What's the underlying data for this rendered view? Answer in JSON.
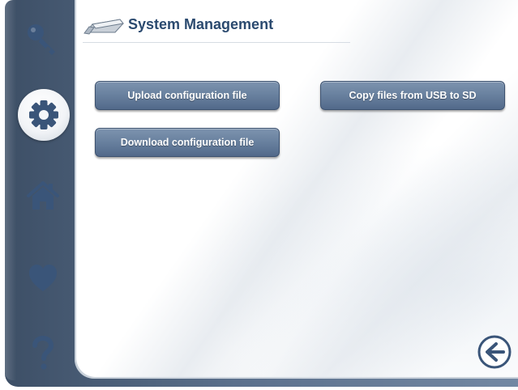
{
  "header": {
    "title": "System Management",
    "icon": "usb-drive-icon"
  },
  "nav": {
    "items": [
      {
        "icon": "key-icon",
        "active": false
      },
      {
        "icon": "gear-icon",
        "active": true
      },
      {
        "icon": "home-icon",
        "active": false
      },
      {
        "icon": "heart-icon",
        "active": false
      },
      {
        "icon": "question-mark-icon",
        "active": false
      }
    ]
  },
  "actions": {
    "upload_config": "Upload configuration file",
    "download_config": "Download configuration file",
    "copy_usb_to_sd": "Copy files from USB to SD"
  },
  "footer": {
    "back_icon": "back-arrow-icon"
  },
  "colors": {
    "rail": "#5b708c",
    "button": "#6a82a0",
    "title": "#2b4a6f",
    "icon": "#3a5579"
  }
}
